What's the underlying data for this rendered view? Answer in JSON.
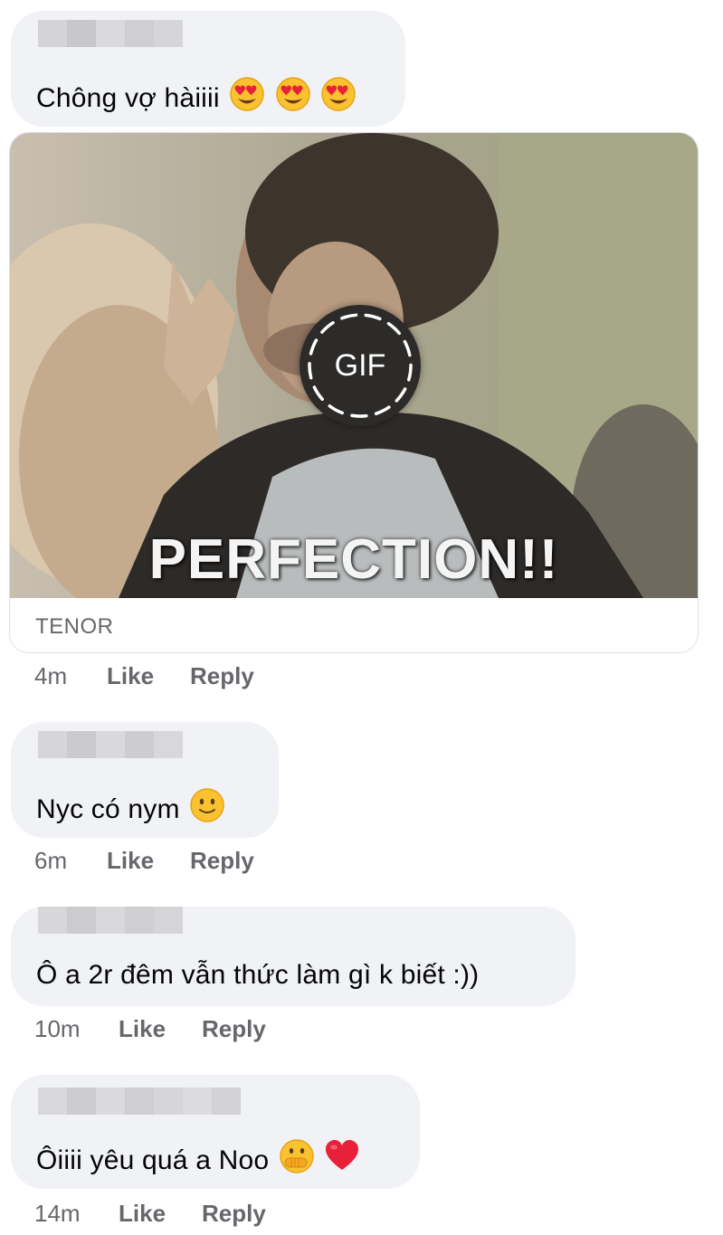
{
  "comments": [
    {
      "text": "Chông vợ hàiiii",
      "emoji_names": [
        "heart-eyes-emoji",
        "heart-eyes-emoji",
        "heart-eyes-emoji"
      ],
      "time": "4m",
      "like_label": "Like",
      "reply_label": "Reply",
      "gif": {
        "caption": "PERFECTION!!",
        "badge_label": "GIF",
        "source_label": "TENOR"
      }
    },
    {
      "text": "Nyc có nym",
      "emoji_names": [
        "slightly-smiling-emoji"
      ],
      "time": "6m",
      "like_label": "Like",
      "reply_label": "Reply"
    },
    {
      "text": "Ô a 2r đêm vẫn thức làm gì k biết :))",
      "time": "10m",
      "like_label": "Like",
      "reply_label": "Reply"
    },
    {
      "text": "Ôiiii yêu quá a Noo",
      "emoji_names": [
        "hand-over-mouth-emoji",
        "red-heart-emoji"
      ],
      "time": "14m",
      "like_label": "Like",
      "reply_label": "Reply"
    }
  ],
  "colors": {
    "bubble_bg": "#f0f2f5",
    "meta_text": "#65676b",
    "text": "#050505"
  }
}
